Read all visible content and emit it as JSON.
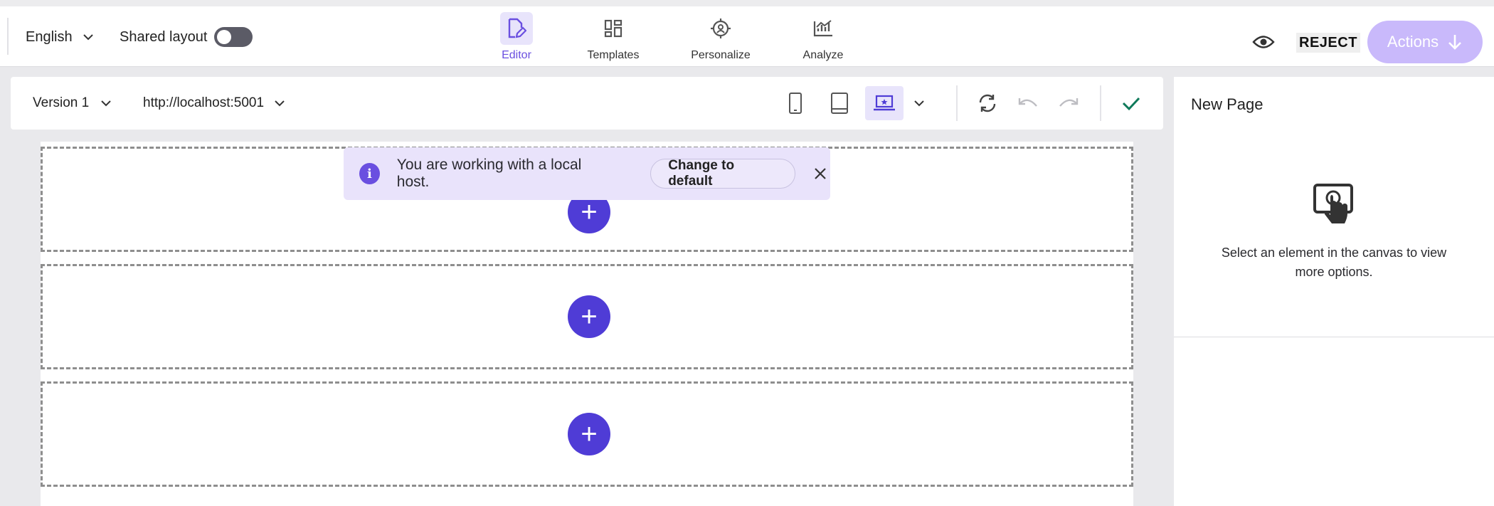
{
  "topbar": {
    "language": "English",
    "shared_layout_label": "Shared layout",
    "shared_layout_on": false,
    "tabs": [
      {
        "label": "Editor",
        "icon": "editor-icon",
        "active": true
      },
      {
        "label": "Templates",
        "icon": "templates-icon",
        "active": false
      },
      {
        "label": "Personalize",
        "icon": "personalize-icon",
        "active": false
      },
      {
        "label": "Analyze",
        "icon": "analyze-icon",
        "active": false
      }
    ],
    "preview_icon": "eye-icon",
    "reject_label": "REJECT",
    "actions_label": "Actions"
  },
  "subbar": {
    "version": "Version 1",
    "url": "http://localhost:5001",
    "devices": [
      "mobile-icon",
      "tablet-icon",
      "desktop-icon"
    ],
    "active_device": "desktop"
  },
  "canvas": {
    "sections": 3,
    "add_icon": "plus-icon"
  },
  "toast": {
    "message": "You are working with a local host.",
    "button": "Change to default"
  },
  "panel": {
    "title": "New Page",
    "hint": "Select an element in the canvas to view more options."
  },
  "colors": {
    "accent": "#4f3cd6",
    "accent_light": "#e8e4fb",
    "actions_bg": "#c9b9fb",
    "confirm": "#0f7a5a"
  }
}
